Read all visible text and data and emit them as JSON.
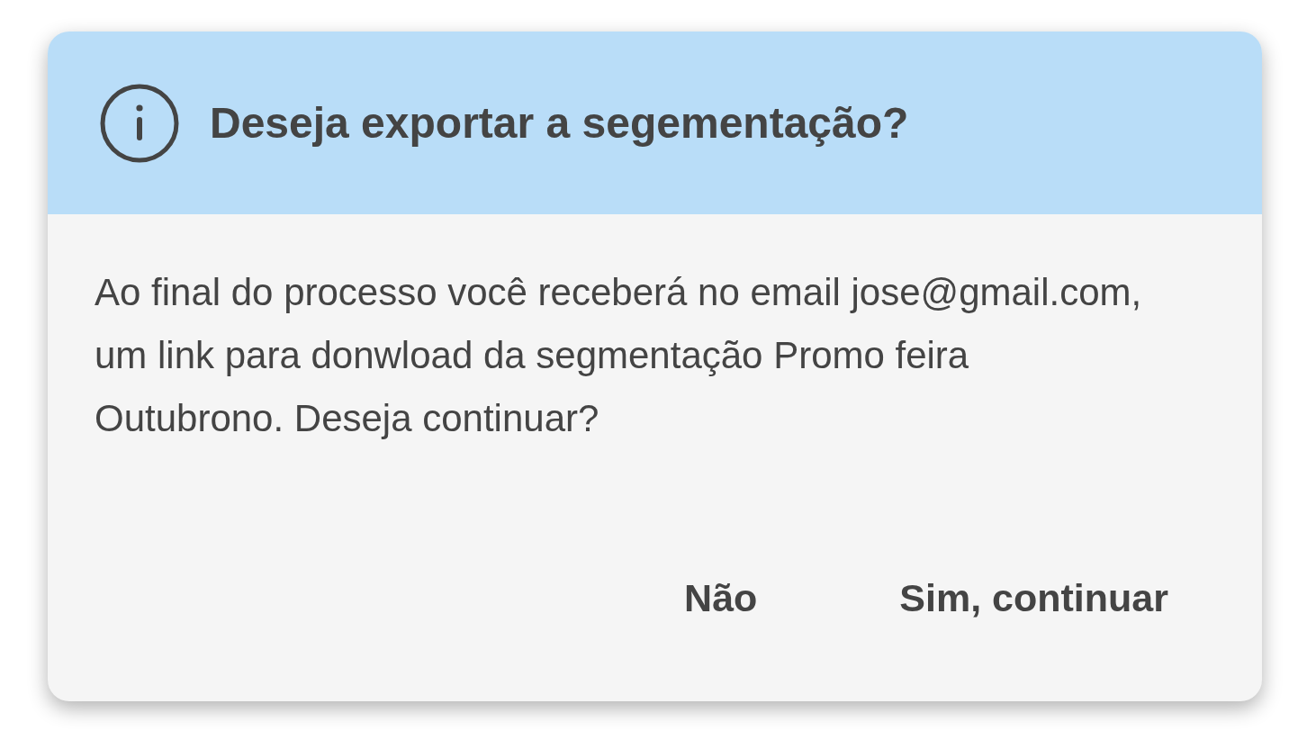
{
  "dialog": {
    "title": "Deseja exportar a segementação?",
    "message": "Ao final do processo você receberá no email jose@gmail.com, um link para donwload da segmentação Promo feira Outubrono. Deseja continuar?",
    "buttons": [
      "Não",
      "Sim, continuar"
    ]
  }
}
